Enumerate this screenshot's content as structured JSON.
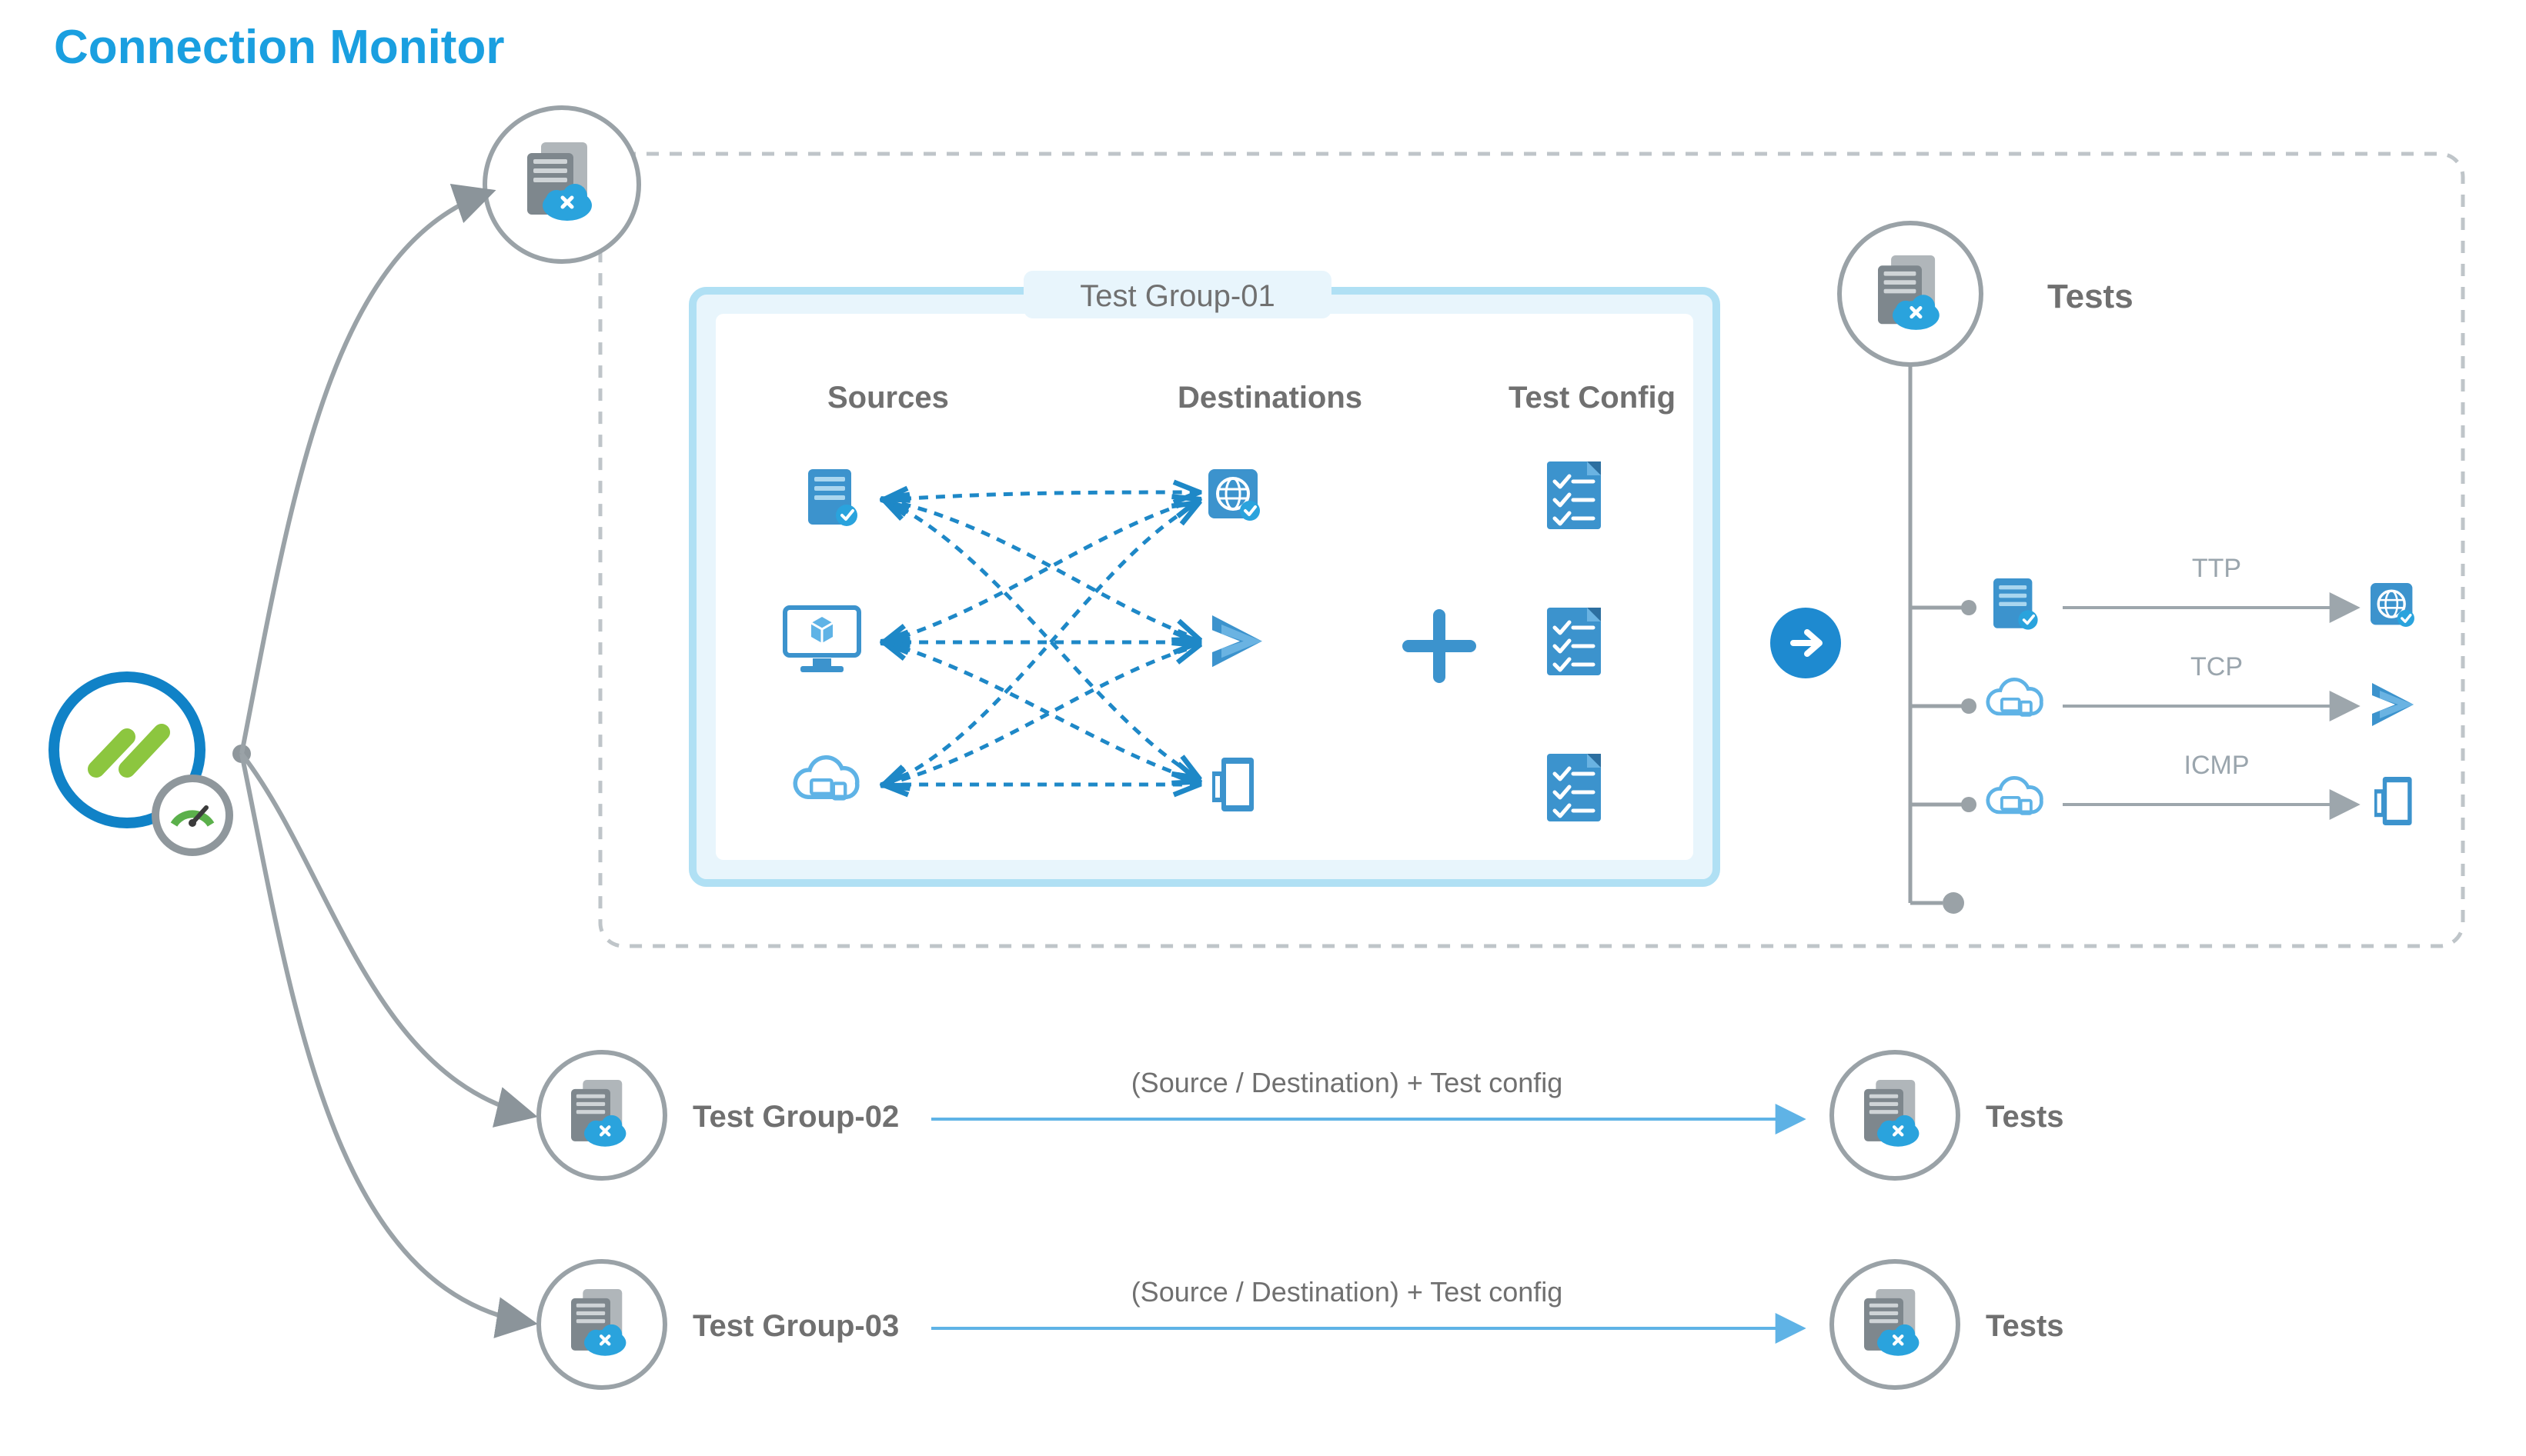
{
  "title": "Connection Monitor",
  "testGroup1": {
    "label": "Test Group-01",
    "columns": {
      "sources": "Sources",
      "destinations": "Destinations",
      "testConfig": "Test Config"
    }
  },
  "tests": {
    "label": "Tests",
    "rows": [
      {
        "protocol": "TTP"
      },
      {
        "protocol": "TCP"
      },
      {
        "protocol": "ICMP"
      }
    ]
  },
  "rows": [
    {
      "group": "Test Group-02",
      "middle": "(Source / Destination) + Test config",
      "right": "Tests"
    },
    {
      "group": "Test Group-03",
      "middle": "(Source / Destination) + Test config",
      "right": "Tests"
    }
  ],
  "colors": {
    "title": "#1a9fe0",
    "gray": "#8f8f8f",
    "grayLine": "#9da6ac",
    "lightBlueFill": "#e8f5fc",
    "lightBlueBorder": "#b0e0f4",
    "mediumBlue": "#5fb3e6",
    "darkBlue": "#3a8ac4",
    "dashedBlue": "#1e88c7",
    "green": "#8cc63f",
    "circleBlue": "#1082c7",
    "nodeGray": "#6f7d86"
  }
}
